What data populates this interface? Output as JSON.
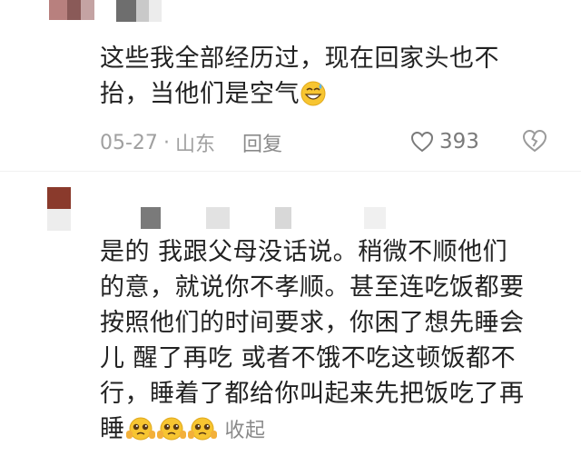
{
  "comments": [
    {
      "text_lines": [
        "这些我全部经历过，现在回家头也不",
        "抬，当他们是空气"
      ],
      "emoji": "sweat-smile-emoji",
      "date": "05-27",
      "separator": "·",
      "location": "山东",
      "reply_label": "回复",
      "likes": "393"
    },
    {
      "text_lines": [
        "是的 我跟父母没话说。稍微不顺他们",
        "的意，就说你不孝顺。甚至连吃饭都要",
        "按照他们的时间要求，你困了想先睡会",
        "儿 醒了再吃 或者不饿不吃这顿饭都不",
        "行，睡着了都给你叫起来先把饭吃了再",
        "睡"
      ],
      "emojis": [
        "pleading-emoji",
        "pleading-emoji",
        "pleading-emoji"
      ],
      "collapse_label": "收起"
    }
  ],
  "colors": {
    "text": "#222222",
    "meta": "#a0a0a0",
    "accent_emoji": "#f7c531"
  }
}
